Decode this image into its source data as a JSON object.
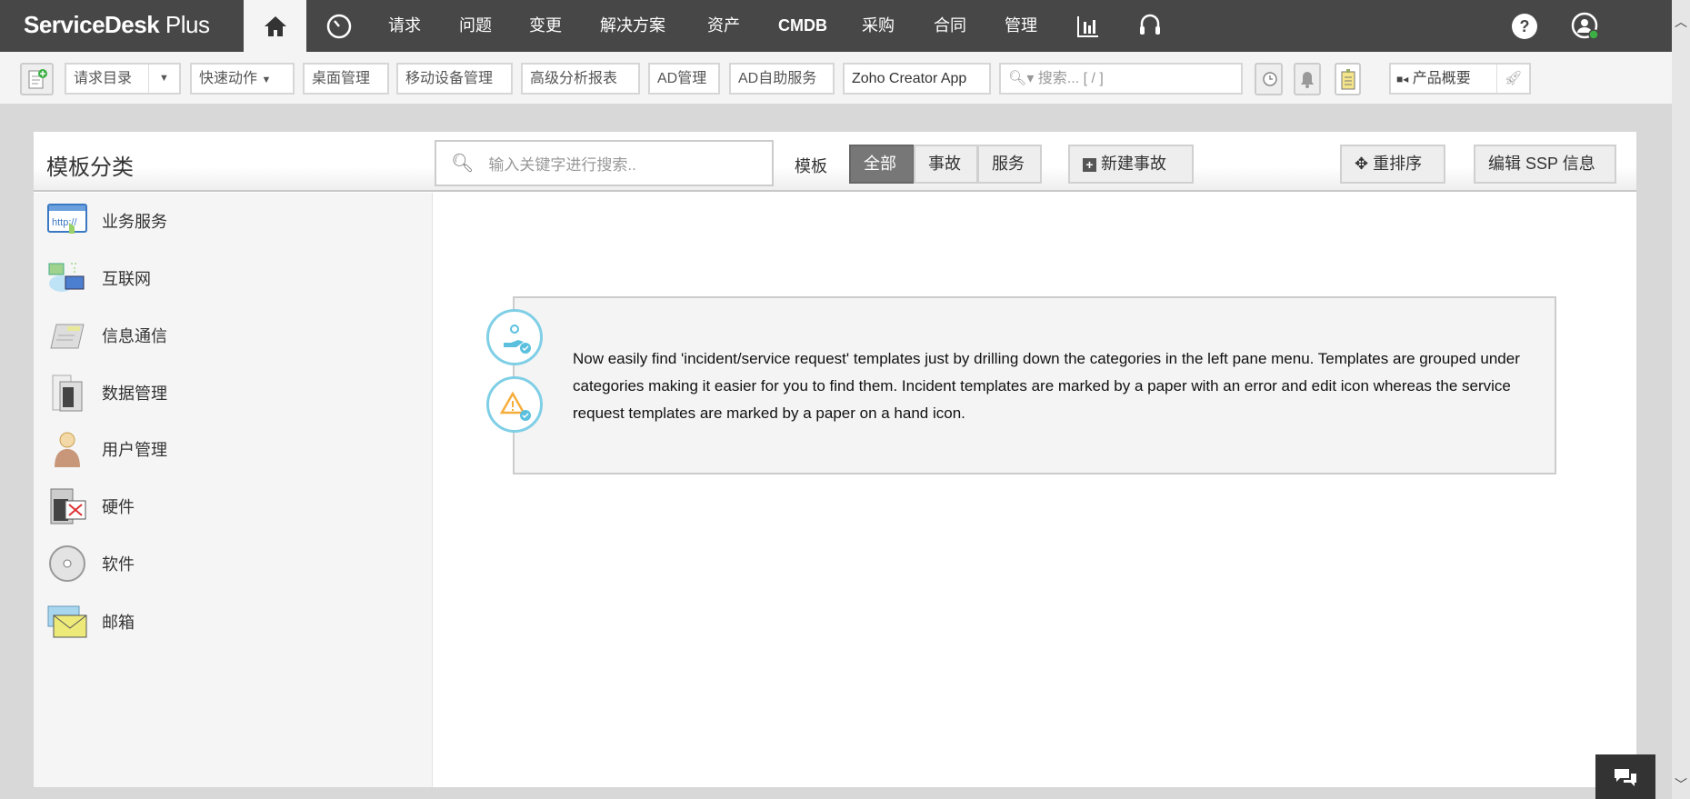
{
  "topnav": {
    "logo": "ServiceDesk Plus",
    "items": [
      "请求",
      "问题",
      "变更",
      "解决方案",
      "资产",
      "CMDB",
      "采购",
      "合同",
      "管理"
    ]
  },
  "toolbar": {
    "request_catalog": "请求目录",
    "quick_actions": "快速动作",
    "links": [
      "桌面管理",
      "移动设备管理",
      "高级分析报表",
      "AD管理",
      "AD自助服务",
      "Zoho Creator App"
    ],
    "search_placeholder": "搜索... [ / ]",
    "product_overview": "产品概要"
  },
  "header": {
    "title": "模板分类",
    "search_placeholder": "输入关键字进行搜索..",
    "template_label": "模板",
    "filters": [
      "全部",
      "事故",
      "服务"
    ],
    "active_filter": "全部",
    "new_incident": "新建事故",
    "reorder": "重排序",
    "edit_ssp": "编辑 SSP 信息"
  },
  "categories": [
    "业务服务",
    "互联网",
    "信息通信",
    "数据管理",
    "用户管理",
    "硬件",
    "软件",
    "邮箱"
  ],
  "info": {
    "text": "Now easily find 'incident/service request' templates just by drilling down the categories in the left pane menu. Templates are grouped under categories making it easier for you to find them. Incident templates are marked by a paper with an error and edit icon whereas the service request templates are marked by a paper on a hand icon."
  },
  "colors": {
    "nav": "#474747",
    "accent": "#7fcfe6",
    "active": "#777777"
  }
}
